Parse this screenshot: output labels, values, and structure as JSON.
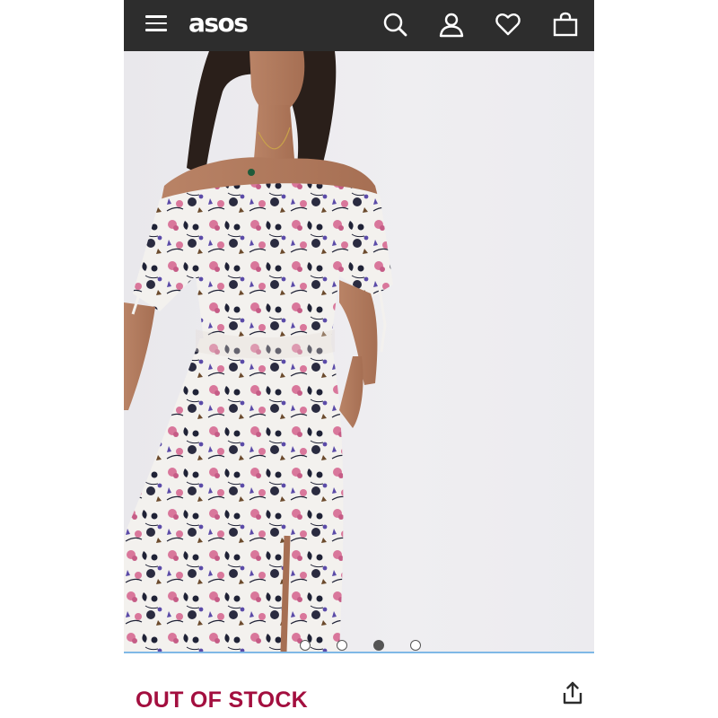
{
  "header": {
    "logo_text": "asos",
    "icons": [
      "menu-icon",
      "search-icon",
      "account-icon",
      "heart-icon",
      "bag-icon"
    ],
    "background_color": "#2d2d2d"
  },
  "gallery": {
    "image_description": "model wearing white floral off-shoulder midi dress",
    "dot_count": 4,
    "active_dot": 3,
    "progress_color": "#7fb8e6"
  },
  "product": {
    "stock_status": "OUT OF STOCK",
    "stock_color": "#a30f3f",
    "share_icon": "share-icon"
  }
}
